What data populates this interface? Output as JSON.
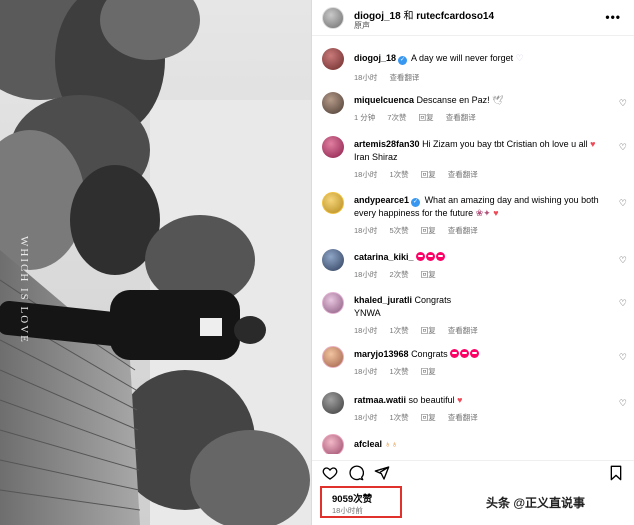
{
  "photo": {
    "vertical_text": "WHICH IS LOVE"
  },
  "header": {
    "user1": "diogoj_18",
    "conj": "和",
    "user2": "rutecfcardoso14",
    "audio": "原声",
    "more": "•••"
  },
  "caption": {
    "user": "diogoj_18",
    "text": "A day we will never forget",
    "time": "18小时",
    "translate": "查看翻译"
  },
  "comments": [
    {
      "user": "miquelcuenca",
      "text": "Descanse en Paz!",
      "time": "1 分钟",
      "likes": "7次赞",
      "reply": "回复",
      "translate": "查看翻译"
    },
    {
      "user": "artemis28fan30",
      "text": "Hi Zizam you bay tbt Cristian oh love u all",
      "text2": "Iran Shiraz",
      "time": "18小时",
      "likes": "1次赞",
      "reply": "回复",
      "translate": "查看翻译"
    },
    {
      "user": "andypearce1",
      "text": "What an amazing day and wishing you both every happiness for the future",
      "time": "18小时",
      "likes": "5次赞",
      "reply": "回复",
      "translate": "查看翻译"
    },
    {
      "user": "catarina_kiki_",
      "text": "",
      "time": "18小时",
      "likes": "2次赞",
      "reply": "回复"
    },
    {
      "user": "khaled_juratli",
      "text": "Congrats",
      "text2": "YNWA",
      "time": "18小时",
      "likes": "1次赞",
      "reply": "回复",
      "translate": "查看翻译"
    },
    {
      "user": "maryjo13968",
      "text": "Congrats",
      "time": "18小时",
      "likes": "1次赞",
      "reply": "回复"
    },
    {
      "user": "ratmaa.watii",
      "text": "so beautiful",
      "time": "18小时",
      "likes": "1次赞",
      "reply": "回复",
      "translate": "查看翻译"
    },
    {
      "user": "afcleal",
      "text": ""
    }
  ],
  "likes": {
    "count": "9059次赞",
    "time": "18小时前"
  },
  "watermark": "头条 @正义直说事",
  "colors": {
    "highlight": "#e0312c",
    "verified": "#3897f0",
    "heart": "#ed4956"
  }
}
